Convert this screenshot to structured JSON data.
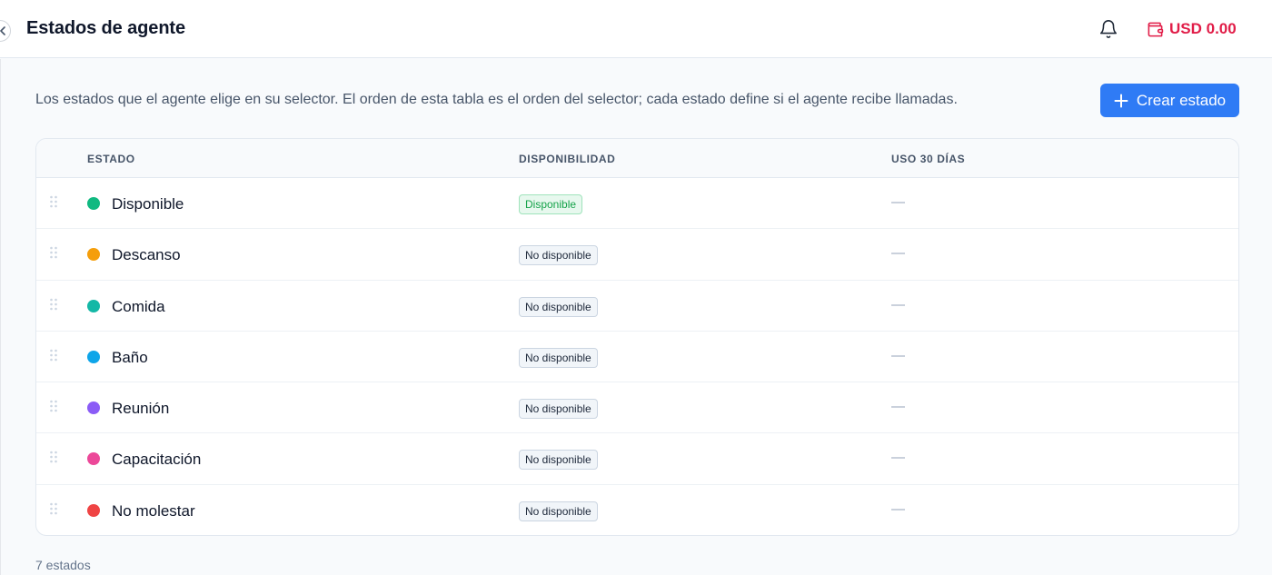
{
  "header": {
    "title": "Estados de agente",
    "balance": "USD 0.00",
    "icons": {
      "collapse": "chevron-left-icon",
      "bell": "bell-icon",
      "wallet": "wallet-icon"
    }
  },
  "main": {
    "description": "Los estados que el agente elige en su selector. El orden de esta tabla es el orden del selector; cada estado define si el agente recibe llamadas.",
    "create_button": "Crear estado",
    "table": {
      "columns": [
        "ESTADO",
        "DISPONIBILIDAD",
        "USO 30 DÍAS"
      ],
      "rows": [
        {
          "name": "Disponible",
          "color": "#10b981",
          "availability": "Disponible",
          "available": true,
          "usage": "—"
        },
        {
          "name": "Descanso",
          "color": "#f59e0b",
          "availability": "No disponible",
          "available": false,
          "usage": "—"
        },
        {
          "name": "Comida",
          "color": "#14b8a6",
          "availability": "No disponible",
          "available": false,
          "usage": "—"
        },
        {
          "name": "Baño",
          "color": "#0ea5e9",
          "availability": "No disponible",
          "available": false,
          "usage": "—"
        },
        {
          "name": "Reunión",
          "color": "#8b5cf6",
          "availability": "No disponible",
          "available": false,
          "usage": "—"
        },
        {
          "name": "Capacitación",
          "color": "#ec4899",
          "availability": "No disponible",
          "available": false,
          "usage": "—"
        },
        {
          "name": "No molestar",
          "color": "#ef4444",
          "availability": "No disponible",
          "available": false,
          "usage": "—"
        }
      ]
    },
    "count_label": "7 estados"
  },
  "colors": {
    "accent": "#2f7bf5",
    "balance": "#e11d48",
    "available_bg": "#e7f8ee",
    "available_text": "#16a34a"
  }
}
